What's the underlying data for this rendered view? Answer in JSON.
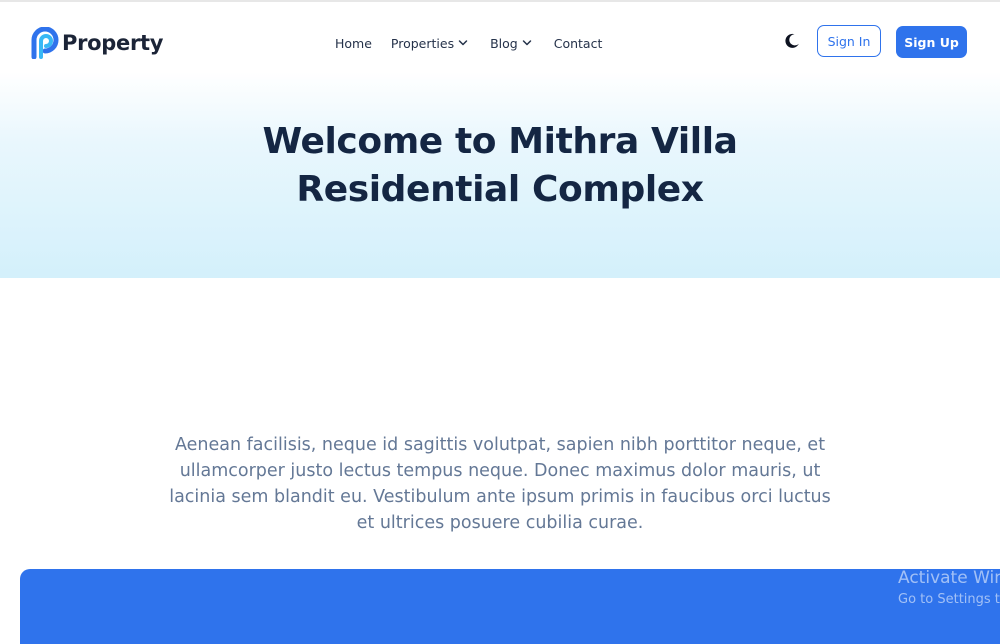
{
  "brand": {
    "name": "Property",
    "accent_color": "#2f73ec",
    "logo_icon": "property-p-logo-icon"
  },
  "nav": {
    "items": [
      {
        "label": "Home",
        "has_dropdown": false
      },
      {
        "label": "Properties",
        "has_dropdown": true
      },
      {
        "label": "Blog",
        "has_dropdown": true
      },
      {
        "label": "Contact",
        "has_dropdown": false
      }
    ]
  },
  "actions": {
    "theme_toggle_icon": "moon-icon",
    "sign_in_label": "Sign In",
    "sign_up_label": "Sign Up"
  },
  "hero": {
    "title_line1": "Welcome to Mithra Villa",
    "title_line2": "Residential Complex"
  },
  "content": {
    "description": "Aenean facilisis, neque id sagittis volutpat, sapien nibh porttitor neque, et ullamcorper justo lectus tempus neque. Donec maximus dolor mauris, ut lacinia sem blandit eu. Vestibulum ante ipsum primis in faucibus orci luctus et ultrices posuere cubilia curae."
  },
  "overlay": {
    "watermark_title": "Activate Windows",
    "watermark_subtitle": "Go to Settings to activate Windows."
  }
}
